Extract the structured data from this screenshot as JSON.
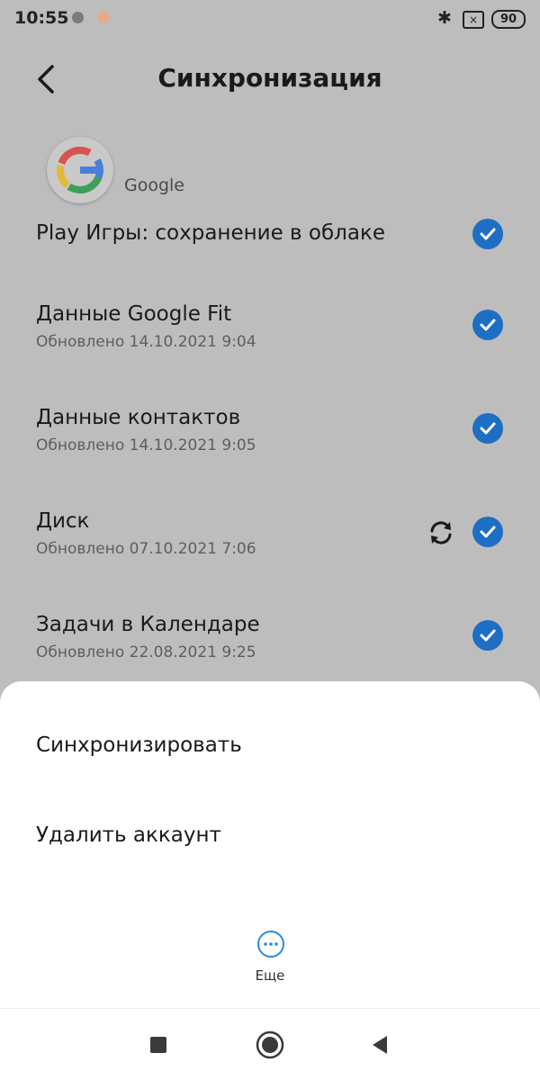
{
  "status_bar": {
    "time": "10:55",
    "battery": "90",
    "sim": "×",
    "bluetooth": "✱",
    "icons": [
      "gray-dot-icon",
      "orange-dot-icon",
      "bluetooth-icon",
      "sim-icon",
      "battery-icon"
    ]
  },
  "header": {
    "title": "Синхронизация",
    "back_icon": "back-arrow-icon"
  },
  "account": {
    "name": "Google",
    "logo_icon": "google-logo-icon"
  },
  "sync_items": [
    {
      "title": "Play Игры: сохранение в облаке",
      "subtitle": "",
      "checked": true
    },
    {
      "title": "Данные Google Fit",
      "subtitle": "Обновлено 14.10.2021 9:04",
      "checked": true
    },
    {
      "title": "Данные контактов",
      "subtitle": "Обновлено 14.10.2021 9:05",
      "checked": true
    },
    {
      "title": "Диск",
      "subtitle": "Обновлено 07.10.2021 7:06",
      "checked": true,
      "syncing": true
    },
    {
      "title": "Задачи в Календаре",
      "subtitle": "Обновлено 22.08.2021 9:25",
      "checked": true
    }
  ],
  "sheet": {
    "sync_label": "Синхронизировать",
    "delete_label": "Удалить аккаунт",
    "more_label": "Еще"
  },
  "nav": {
    "icons": [
      "recents-square-icon",
      "home-circle-icon",
      "back-triangle-icon"
    ]
  },
  "colors": {
    "overlay_bg": "#bdbdbd",
    "check_blue": "#1e6fc4",
    "accent_more": "#2a8bd8"
  }
}
